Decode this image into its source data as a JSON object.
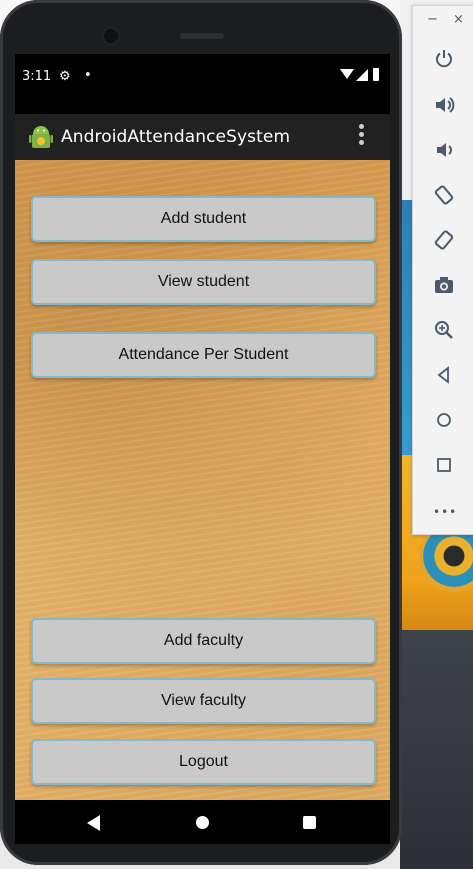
{
  "status_bar": {
    "time": "3:11"
  },
  "app_bar": {
    "title": "AndroidAttendanceSystem"
  },
  "buttons": {
    "add_student": "Add student",
    "view_student": "View student",
    "attendance_per_student": "Attendance Per Student",
    "add_faculty": "Add faculty",
    "view_faculty": "View faculty",
    "logout": "Logout"
  },
  "emulator_toolbar": {
    "minimize": "−",
    "close": "×",
    "more": "•••"
  },
  "icons": {
    "status": [
      "gear-icon",
      "notification-dot-icon",
      "wifi-icon",
      "signal-icon",
      "battery-icon"
    ],
    "app_bar": [
      "android-logo-icon",
      "overflow-menu-icon"
    ],
    "nav": [
      "back-icon",
      "home-icon",
      "recents-icon"
    ],
    "toolbar": [
      "power-icon",
      "volume-up-icon",
      "volume-down-icon",
      "rotate-left-icon",
      "rotate-right-icon",
      "camera-icon",
      "zoom-icon",
      "back-icon",
      "home-icon",
      "overview-icon",
      "more-icon"
    ]
  },
  "colors": {
    "app_bar": "#212121",
    "button_bg": "#c9c9c9",
    "button_border": "#86b8c8",
    "wood": "#e0aa61"
  }
}
